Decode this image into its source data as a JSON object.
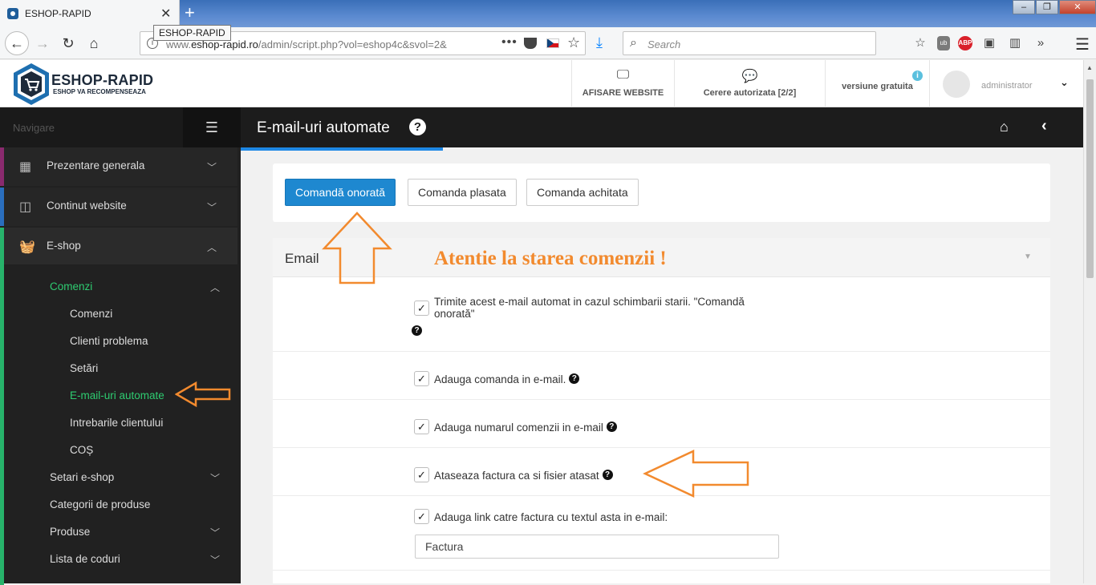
{
  "browser": {
    "tab_title": "ESHOP-RAPID",
    "tab_close": "✕",
    "new_tab": "+",
    "tooltip": "ESHOP-RAPID",
    "url_prefix": "www.",
    "url_domain": "eshop-rapid.ro",
    "url_path": "/admin/script.php?vol=eshop4c&svol=2&",
    "url_more": "•••",
    "search_placeholder": "Search",
    "window_buttons": [
      "–",
      "❐",
      "✕"
    ]
  },
  "header": {
    "logo_title": "ESHOP-RAPID",
    "logo_subtitle": "ESHOP VA RECOMPENSEAZA",
    "view_site_label": "AFISARE WEBSITE",
    "requests_label": "Cerere autorizata [2/2]",
    "version_label": "versiune gratuita",
    "version_info": "i",
    "username": "administrator"
  },
  "sidebar": {
    "nav_label": "Navigare",
    "items": [
      {
        "label": "Prezentare generala",
        "icon": "grid-icon",
        "accent": "#8a2a6e"
      },
      {
        "label": "Continut website",
        "icon": "columns-icon",
        "accent": "#2a6ebd"
      },
      {
        "label": "E-shop",
        "icon": "basket-icon",
        "accent": "#27b36b"
      }
    ],
    "eshop_children": [
      {
        "label": "Comenzi",
        "expanded": true
      },
      {
        "label": "Comenzi"
      },
      {
        "label": "Clienti problema"
      },
      {
        "label": "Setări"
      },
      {
        "label": "E-mail-uri automate",
        "active": true
      },
      {
        "label": "Intrebarile clientului"
      },
      {
        "label": "COȘ"
      },
      {
        "label": "Setari e-shop"
      },
      {
        "label": "Categorii de produse"
      },
      {
        "label": "Produse"
      },
      {
        "label": "Lista de coduri"
      }
    ]
  },
  "content": {
    "title": "E-mail-uri automate",
    "help": "?",
    "tabs": [
      "Comandă onorată",
      "Comanda plasata",
      "Comanda achitata"
    ],
    "section_title": "Email",
    "options": [
      {
        "text": "Trimite acest e-mail automat in cazul schimbarii starii. \"Comandă onorată\"",
        "checked": true
      },
      {
        "text": "Adauga comanda in e-mail.",
        "checked": true
      },
      {
        "text": "Adauga numarul comenzii in e-mail",
        "checked": true
      },
      {
        "text": "Ataseaza factura ca si fisier atasat",
        "checked": true
      },
      {
        "text": "Adauga link catre factura cu textul asta in e-mail:",
        "checked": true
      }
    ],
    "link_text_value": "Factura",
    "annotation": "Atentie la starea comenzii !"
  },
  "colors": {
    "primary": "#1e88d0",
    "active_green": "#2ecc71",
    "annotation_orange": "#f28a2e"
  }
}
